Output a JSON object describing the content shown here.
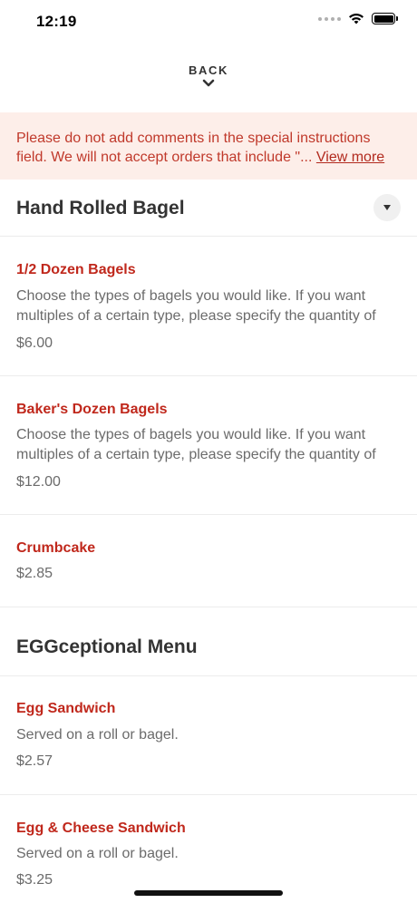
{
  "status_bar": {
    "time": "12:19"
  },
  "back": {
    "label": "BACK"
  },
  "notice": {
    "text": "Please do not add comments in the special instructions field. We will not accept orders that include \"... ",
    "link": "View more"
  },
  "sections": [
    {
      "title": "Hand Rolled Bagel",
      "items": [
        {
          "name": "1/2 Dozen Bagels",
          "description": "Choose the types of bagels you would like. If you want multiples of a certain type, please specify the quantity of",
          "price": "$6.00"
        },
        {
          "name": "Baker's Dozen Bagels",
          "description": "Choose the types of bagels you would like. If you want multiples of a certain type, please specify the quantity of",
          "price": "$12.00"
        },
        {
          "name": "Crumbcake",
          "description": "",
          "price": "$2.85"
        }
      ]
    },
    {
      "title": "EGGceptional Menu",
      "items": [
        {
          "name": "Egg Sandwich",
          "description": "Served on a roll or bagel.",
          "price": "$2.57"
        },
        {
          "name": "Egg & Cheese Sandwich",
          "description": "Served on a roll or bagel.",
          "price": "$3.25"
        }
      ]
    }
  ],
  "colors": {
    "accent": "#c0281c",
    "notice_bg": "#fdeee9"
  }
}
